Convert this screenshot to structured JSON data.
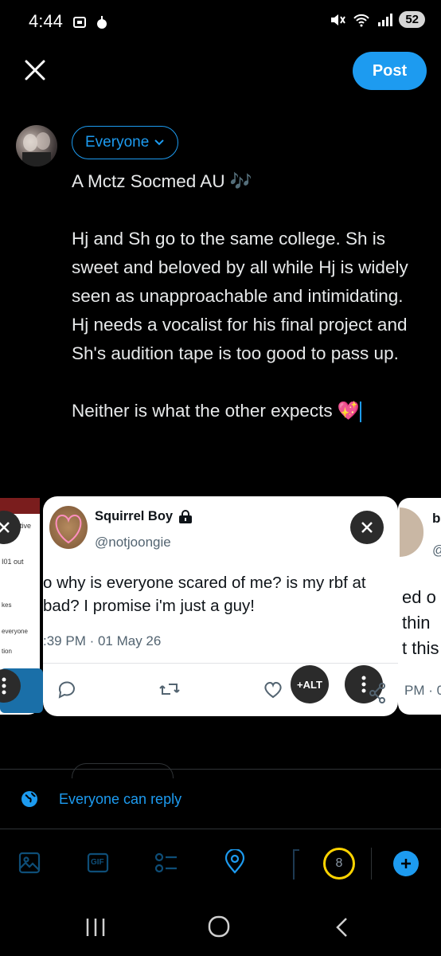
{
  "status": {
    "time": "4:44",
    "battery": "52"
  },
  "header": {
    "post_label": "Post"
  },
  "audience": {
    "label": "Everyone"
  },
  "compose": {
    "text": "A Mctz Socmed AU 🎶\n\nHj and Sh go to the same college. Sh is sweet and beloved by all while Hj is widely seen as unapproachable and intimidating.\nHj needs a vocalist for his final project and Sh's audition tape is too good to pass up.\n\nNeither is what the other expects 💖"
  },
  "tweet_card": {
    "name": "Squirrel Boy",
    "handle": "@notjoongie",
    "text": "o why is everyone scared of me? is my rbf at bad? I promise i'm just a guy!",
    "timestamp": ":39 PM · 01 May 26",
    "alt_label": "+ALT"
  },
  "left_card": {
    "snippet_1": "otive",
    "snippet_2": "I01 out",
    "snippet_3": "kes",
    "snippet_4": "everyone",
    "snippet_5": "tion"
  },
  "right_card": {
    "line_1": "b",
    "line_2": "@",
    "line_3": "ed o",
    "line_4": "thin",
    "line_5": "t this",
    "line_6": "PM · 0"
  },
  "reply_setting": {
    "label": "Everyone can reply"
  },
  "toolbar": {
    "char_count": "8",
    "gif_label": "GIF"
  },
  "colors": {
    "accent": "#1d9bf0",
    "counter": "#ffd400",
    "background": "#000000"
  }
}
